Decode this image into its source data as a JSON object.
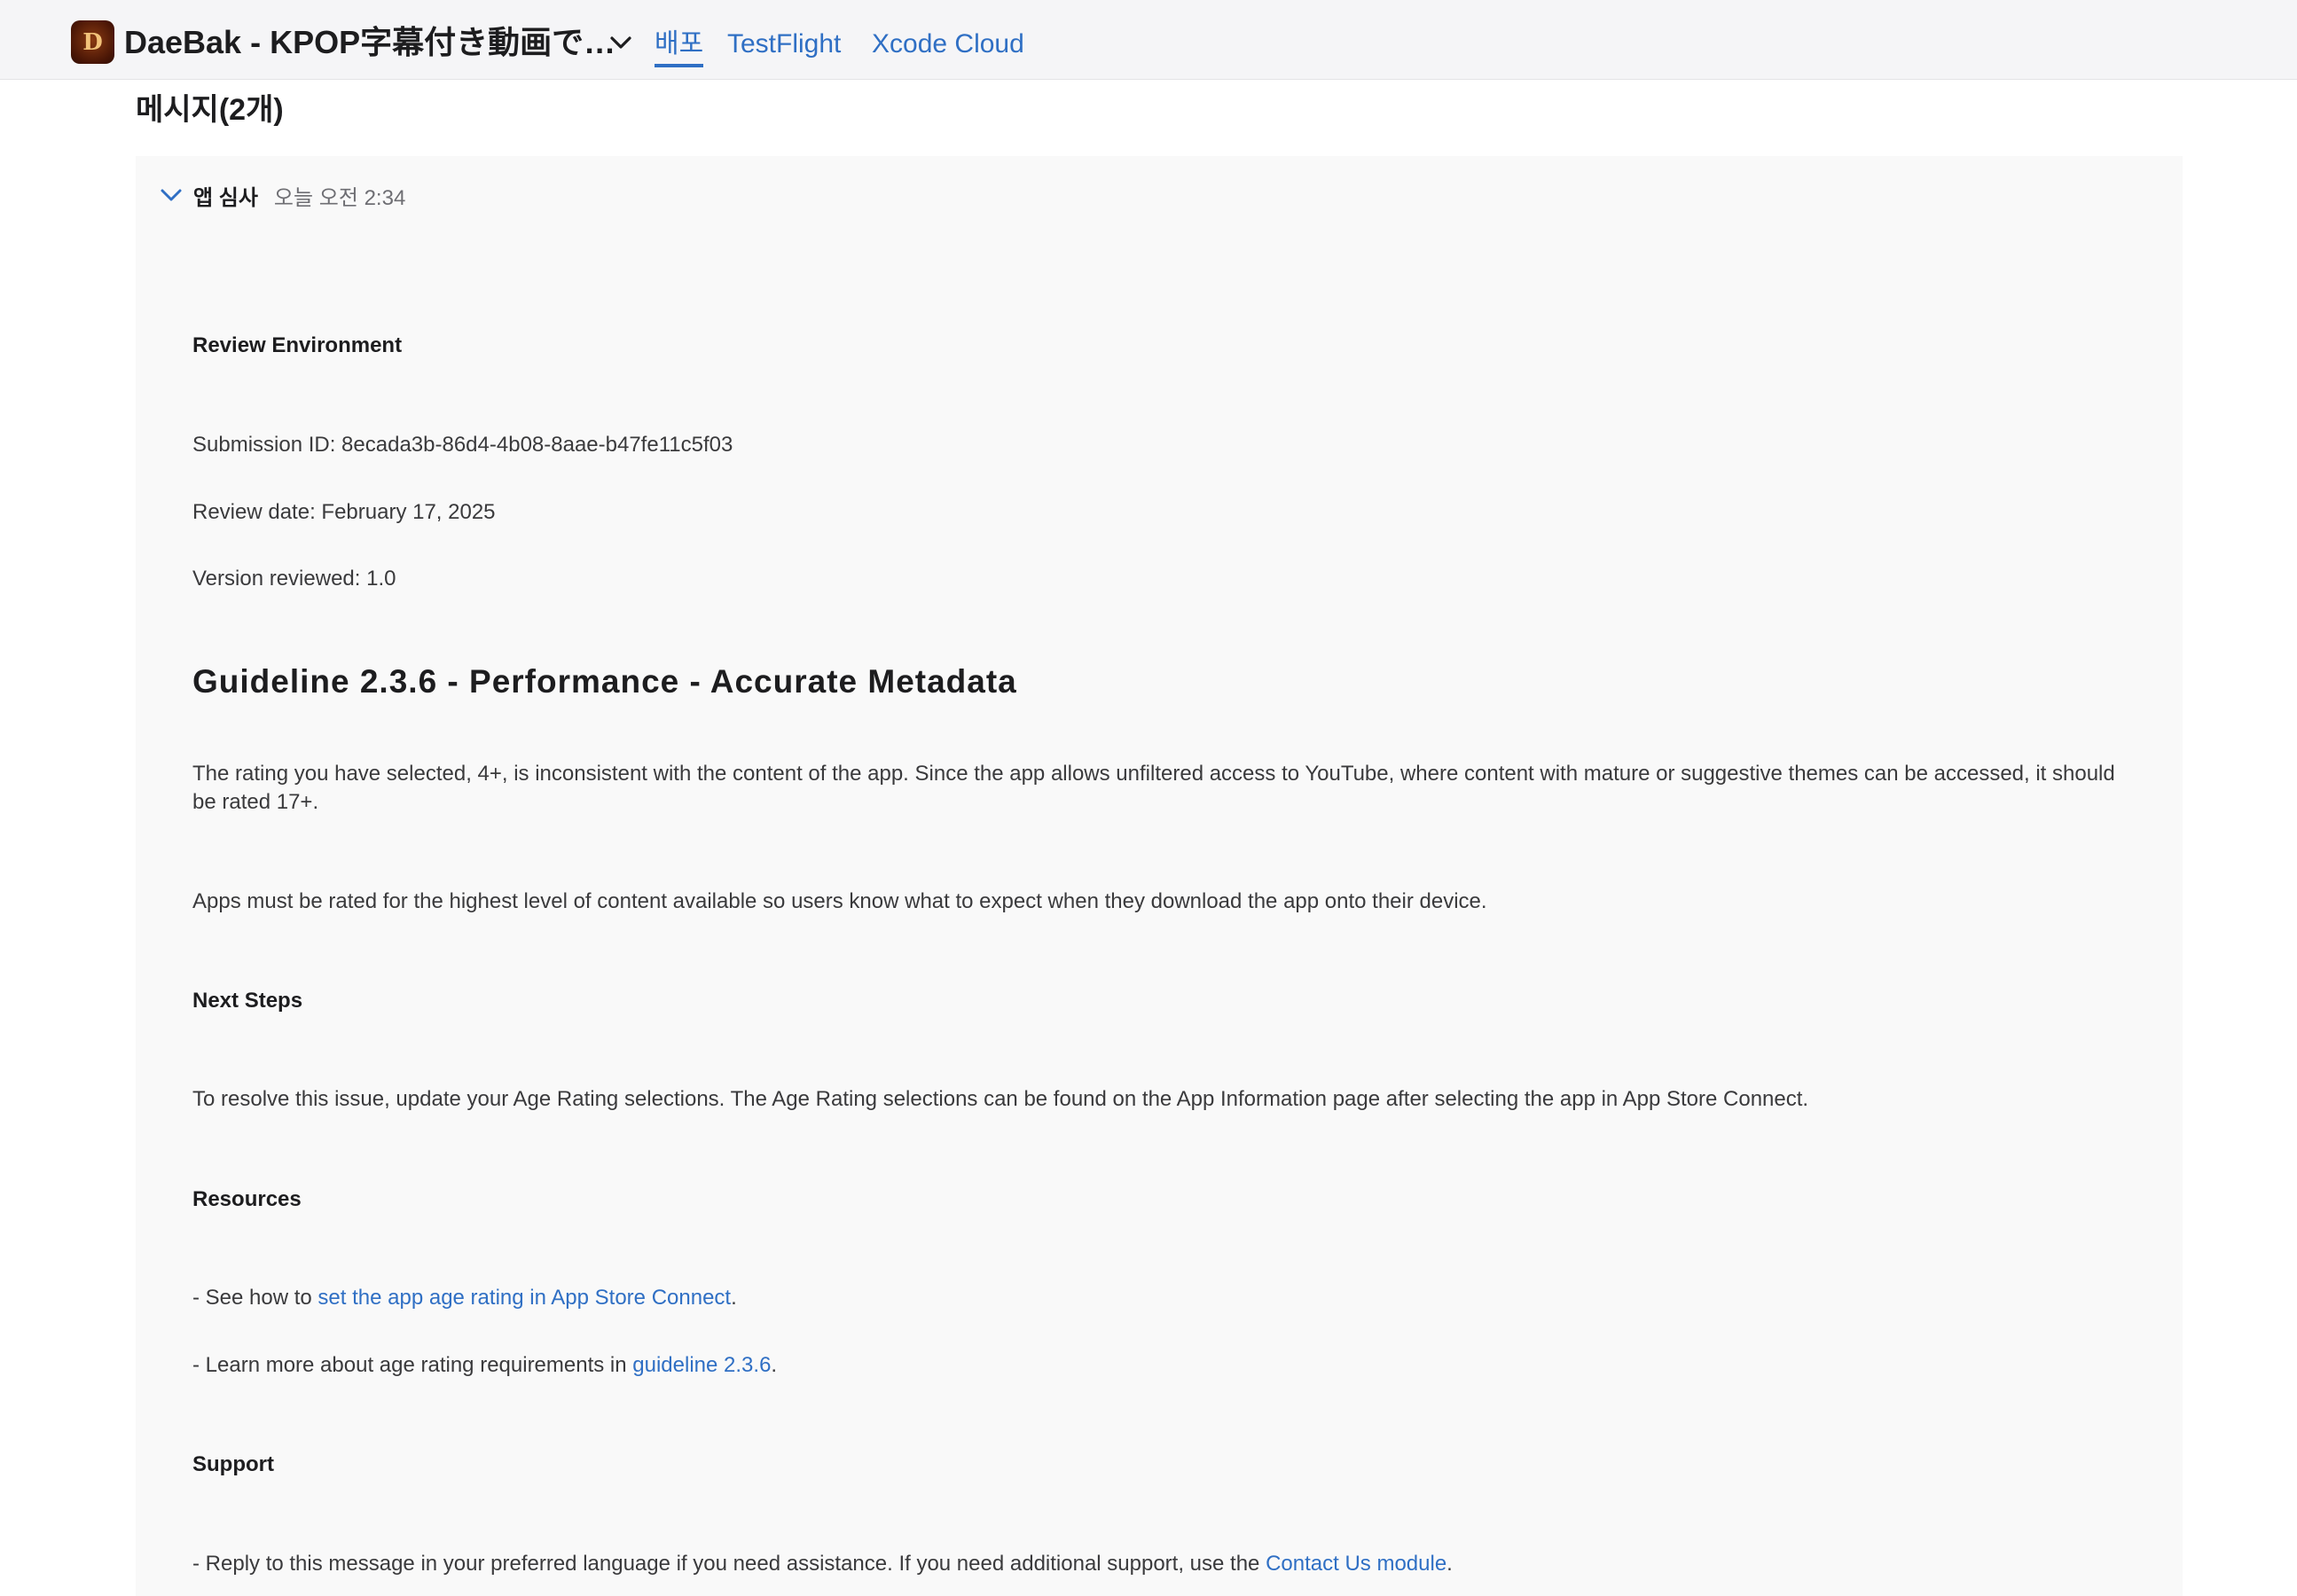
{
  "header": {
    "app_icon_letter": "D",
    "app_title": "DaeBak - KPOP字幕付き動画で…",
    "tabs": [
      {
        "label": "배포",
        "active": true
      },
      {
        "label": "TestFlight",
        "active": false
      },
      {
        "label": "Xcode Cloud",
        "active": false
      }
    ]
  },
  "page": {
    "title": "메시지(2개)"
  },
  "message": {
    "sender": "앱 심사",
    "timestamp": "오늘 오전 2:34",
    "review_environment_heading": "Review Environment",
    "submission_id": "Submission ID: 8ecada3b-86d4-4b08-8aae-b47fe11c5f03",
    "review_date": "Review date: February 17, 2025",
    "version_reviewed": "Version reviewed: 1.0",
    "guideline_heading": "Guideline 2.3.6 - Performance - Accurate Metadata",
    "paragraph_1": "The rating you have selected, 4+, is inconsistent with the content of the app. Since the app allows unfiltered access to YouTube, where content with mature or suggestive themes can be accessed, it should be rated 17+.",
    "paragraph_2": "Apps must be rated for the highest level of content available so users know what to expect when they download the app onto their device.",
    "next_steps_heading": "Next Steps",
    "next_steps_text": "To resolve this issue, update your Age Rating selections. The Age Rating selections can be found on the App Information page after selecting the app in App Store Connect.",
    "resources_heading": "Resources",
    "resource_1_prefix": "- See how to ",
    "resource_1_link": "set the app age rating in App Store Connect",
    "resource_1_suffix": ".",
    "resource_2_prefix": "- Learn more about age rating requirements in ",
    "resource_2_link": "guideline 2.3.6",
    "resource_2_suffix": ".",
    "support_heading": "Support",
    "support_prefix": "- Reply to this message in your preferred language if you need assistance. If you need additional support, use the ",
    "support_link": "Contact Us module",
    "support_suffix": "."
  },
  "colors": {
    "accent": "#2f6fc4",
    "header_bg": "#f5f5f7",
    "panel_bg": "#f9f9f9"
  },
  "icons": {
    "app_dropdown": "chevron-down-icon",
    "message_toggle": "chevron-down-icon"
  }
}
